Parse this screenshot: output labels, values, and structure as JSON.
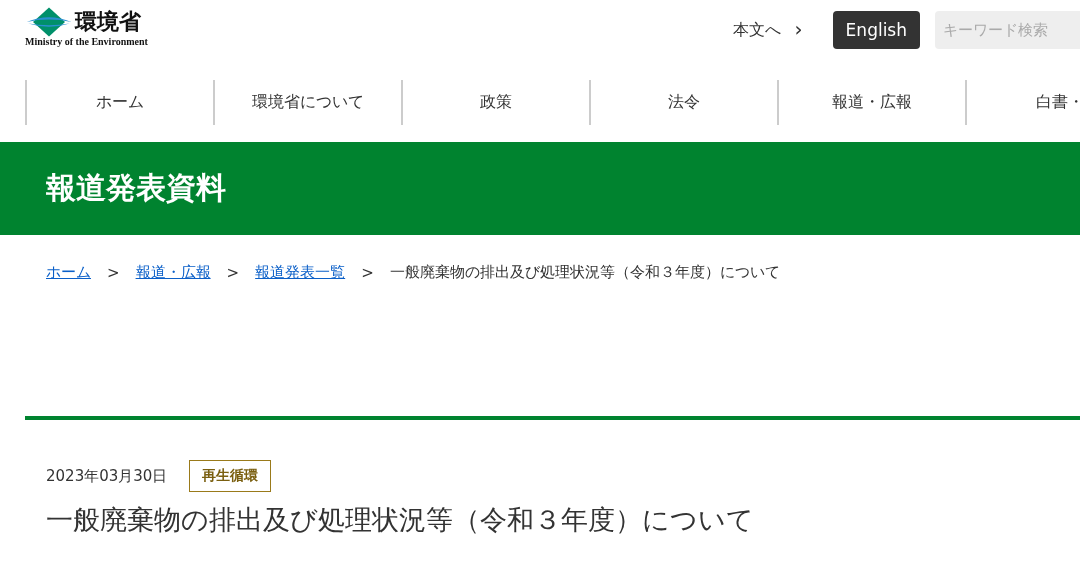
{
  "logo": {
    "name": "環境省",
    "subtitle": "Ministry of the Environment"
  },
  "header": {
    "skip_link": "本文へ",
    "skip_arrow": "›",
    "language_button": "English",
    "search": {
      "placeholder": "キーワード検索"
    }
  },
  "nav": [
    {
      "label": "ホーム"
    },
    {
      "label": "環境省について"
    },
    {
      "label": "政策"
    },
    {
      "label": "法令"
    },
    {
      "label": "報道・広報"
    },
    {
      "label": "白書・"
    }
  ],
  "banner": {
    "title": "報道発表資料"
  },
  "breadcrumb": [
    {
      "label": "ホーム",
      "kind": "link"
    },
    {
      "label": "報道・広報",
      "kind": "link"
    },
    {
      "label": "報道発表一覧",
      "kind": "link"
    },
    {
      "label": "一般廃棄物の排出及び処理状況等（令和３年度）について",
      "kind": "current"
    }
  ],
  "breadcrumb_separator": ">",
  "article": {
    "date": "2023年03月30日",
    "tag": "再生循環",
    "title": "一般廃棄物の排出及び処理状況等（令和３年度）について"
  }
}
